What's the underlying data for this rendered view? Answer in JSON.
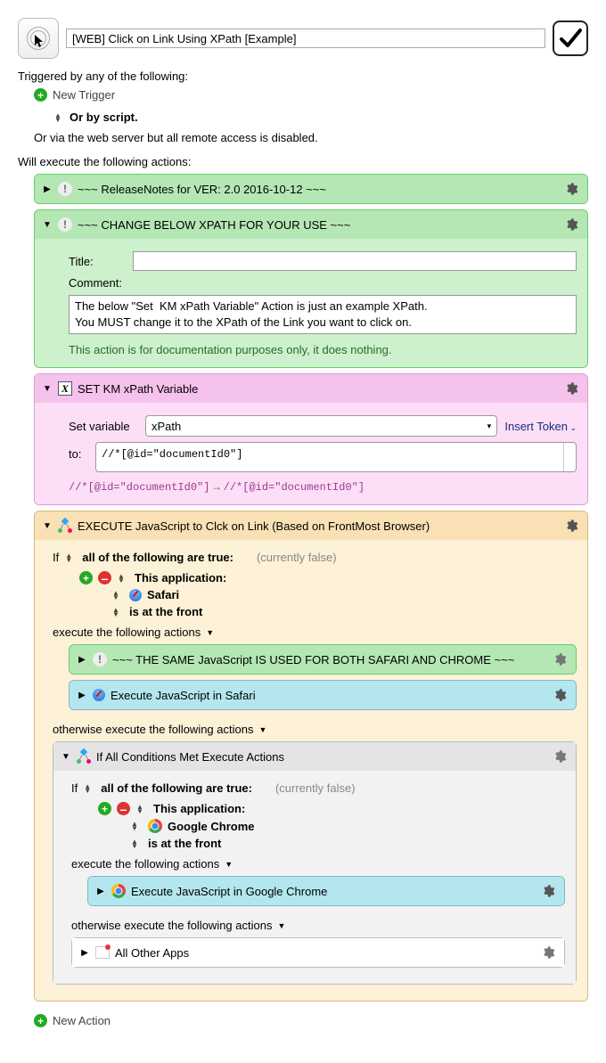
{
  "header": {
    "macro_title": "[WEB] Click on Link Using XPath [Example]"
  },
  "triggers": {
    "section_label": "Triggered by any of the following:",
    "new_trigger": "New Trigger",
    "or_by_script": "Or by script.",
    "web_server_note": "Or via the web server but all remote access is disabled."
  },
  "actions_section_label": "Will execute the following actions:",
  "actions": {
    "release_notes": {
      "title": "~~~ ReleaseNotes for  VER: 2.0     2016-10-12  ~~~"
    },
    "change_xpath": {
      "title": "~~~ CHANGE BELOW XPATH FOR YOUR USE ~~~",
      "title_label": "Title:",
      "title_value": "",
      "comment_label": "Comment:",
      "comment_value": "The below \"Set  KM xPath Variable\" Action is just an example XPath.\nYou MUST change it to the XPath of the Link you want to click on.",
      "footer_note": "This action is for documentation purposes only, it does nothing."
    },
    "set_var": {
      "title": "SET KM xPath Variable",
      "set_var_label": "Set variable",
      "var_name": "xPath",
      "insert_token": "Insert Token",
      "to_label": "to:",
      "to_value": "//*[@id=\"documentId0\"]",
      "eval_left": "//*[@id=\"documentId0\"]",
      "eval_right": "//*[@id=\"documentId0\"]"
    },
    "exec_js": {
      "title": "EXECUTE JavaScript to Clck on Link (Based on FrontMost Browser)",
      "if_label": "If",
      "cond_phrase": "all of the following are true:",
      "status": "(currently false)",
      "this_app": "This application:",
      "safari": "Safari",
      "is_front": "is at the front",
      "exec_label": "execute the following actions",
      "same_js_title": "~~~ THE SAME JavaScript IS USED FOR BOTH SAFARI AND CHROME ~~~",
      "exec_safari_title": "Execute JavaScript in Safari",
      "otherwise_label": "otherwise execute the following actions",
      "inner_if": {
        "title": "If All Conditions Met Execute Actions",
        "if_label": "If",
        "cond_phrase": "all of the following are true:",
        "status": "(currently false)",
        "this_app": "This application:",
        "chrome": "Google Chrome",
        "is_front": "is at the front",
        "exec_label": "execute the following actions",
        "exec_chrome_title": "Execute JavaScript in Google Chrome",
        "otherwise_label": "otherwise execute the following actions",
        "all_other_title": "All Other Apps"
      }
    }
  },
  "new_action": "New Action"
}
